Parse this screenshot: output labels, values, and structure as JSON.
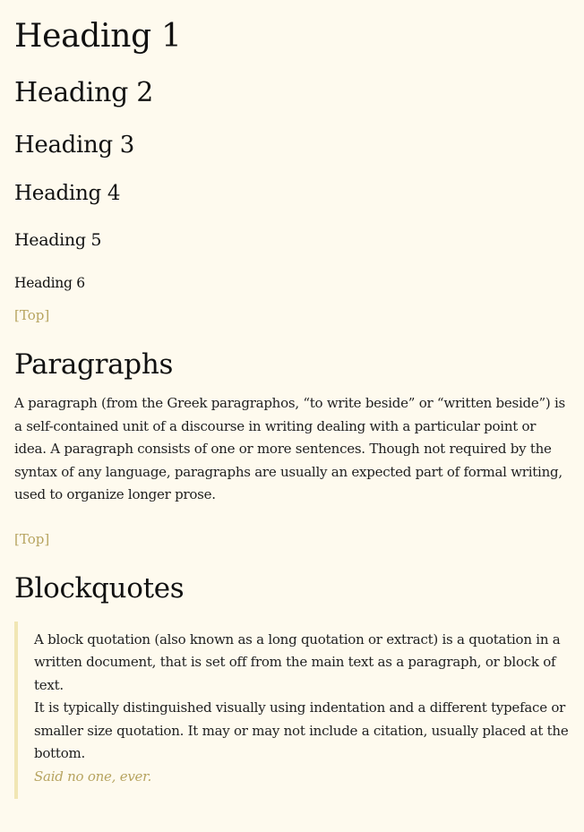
{
  "headings": {
    "h1": "Heading 1",
    "h2": "Heading 2",
    "h3": "Heading 3",
    "h4": "Heading 4",
    "h5": "Heading 5",
    "h6": "Heading 6"
  },
  "top_link_label": "[Top]",
  "paragraphs_section": {
    "title": "Paragraphs",
    "text": "A paragraph (from the Greek paragraphos, “to write beside” or “written beside”) is a self-contained unit of a discourse in writing dealing with a particular point or idea. A paragraph consists of one or more sentences. Though not required by the syntax of any language, paragraphs are usually an expected part of formal writing, used to organize longer prose."
  },
  "blockquotes_section": {
    "title": "Blockquotes",
    "quote_line1": "A block quotation (also known as a long quotation or extract) is a quotation in a written document, that is set off from the main text as a paragraph, or block of text.",
    "quote_line2": "It is typically distinguished visually using indentation and a different typeface or smaller size quotation. It may or may not include a citation, usually placed at the bottom.",
    "citation": "Said no one, ever."
  },
  "colors": {
    "background": "#fefaee",
    "link": "#b7a460",
    "quote_border": "#f1e6b4"
  }
}
